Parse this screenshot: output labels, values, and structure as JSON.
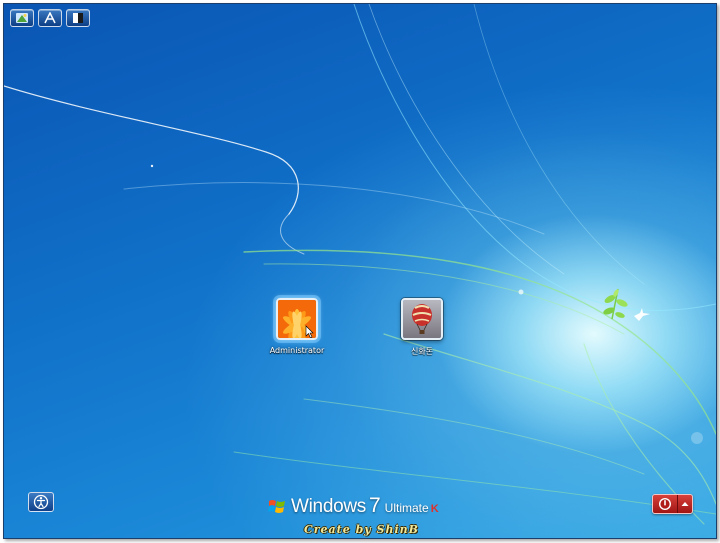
{
  "screen": {
    "type": "windows-logon",
    "colors": {
      "background": "#1070c8",
      "glow": "#eaffff",
      "power_button": "#c0251f",
      "creator_text": "#f1e89a"
    }
  },
  "toolbar": {
    "items": [
      {
        "icon": "display-options-icon"
      },
      {
        "icon": "font-icon"
      },
      {
        "icon": "high-contrast-icon"
      }
    ]
  },
  "users": [
    {
      "name": "Administrator",
      "picture": "orange-flower",
      "selected": true
    },
    {
      "name": "신화돈",
      "picture": "hot-air-balloon",
      "selected": false
    }
  ],
  "ease_of_access": {
    "icon": "ease-of-access-icon"
  },
  "branding": {
    "windows": "Windows",
    "version": "7",
    "edition": "Ultimate",
    "mark": "K"
  },
  "creator": "Create by ShinB",
  "power": {
    "icon": "power-icon",
    "menu_icon": "arrow-up-icon"
  }
}
